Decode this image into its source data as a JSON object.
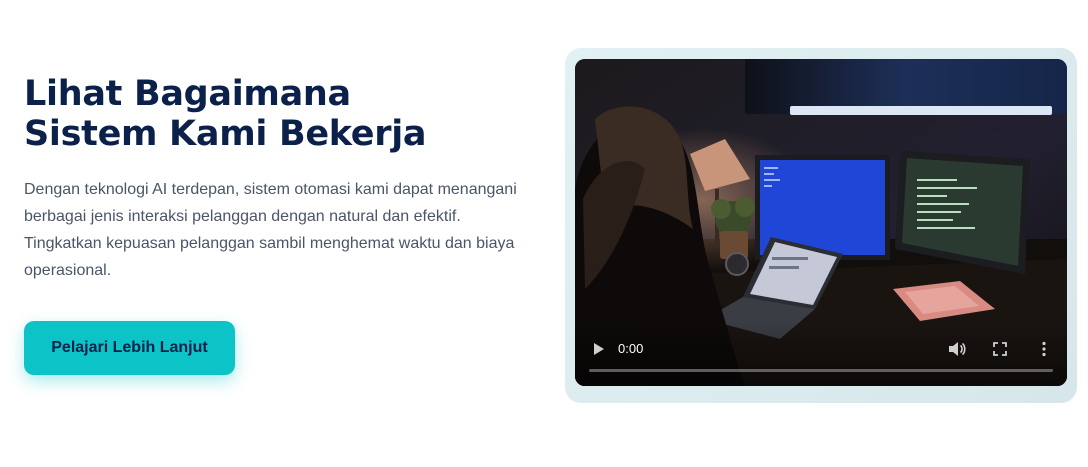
{
  "hero": {
    "title": "Lihat Bagaimana Sistem Kami Bekerja",
    "description": "Dengan teknologi AI terdepan, sistem otomasi kami dapat menangani berbagai jenis interaksi pelanggan dengan natural dan efektif. Tingkatkan kepuasan pelanggan sambil menghemat waktu dan biaya operasional.",
    "cta_label": "Pelajari Lebih Lanjut"
  },
  "video": {
    "current_time": "0:00",
    "progress": 0,
    "icons": {
      "play": "play-icon",
      "volume": "volume-icon",
      "fullscreen": "fullscreen-icon",
      "more": "more-options-icon"
    }
  },
  "colors": {
    "title": "#0b2149",
    "text": "#4a5568",
    "accent": "#0cc4c8"
  }
}
